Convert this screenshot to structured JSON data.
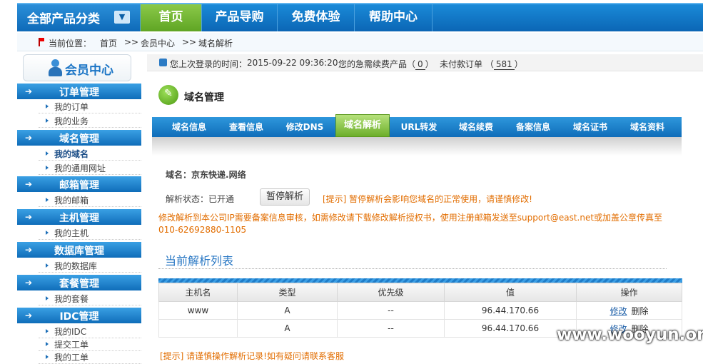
{
  "topnav": {
    "category_label": "全部产品分类",
    "arrow_glyph": "▼",
    "items": [
      "首页",
      "产品导购",
      "免费体验",
      "帮助中心"
    ]
  },
  "breadcrumb": {
    "label": "当前位置：",
    "sep": ">>",
    "items": [
      "首页",
      "会员中心",
      "域名解析"
    ]
  },
  "sidebar": {
    "title": "会员中心",
    "sections": [
      {
        "title": "订单管理",
        "items": [
          "我的订单",
          "我的业务"
        ]
      },
      {
        "title": "域名管理",
        "items": [
          "我的域名",
          "我的通用网址"
        ]
      },
      {
        "title": "邮箱管理",
        "items": [
          "我的邮箱"
        ]
      },
      {
        "title": "主机管理",
        "items": [
          "我的主机"
        ]
      },
      {
        "title": "数据库管理",
        "items": [
          "我的数据库"
        ]
      },
      {
        "title": "套餐管理",
        "items": [
          "我的套餐"
        ]
      },
      {
        "title": "IDC管理",
        "items": [
          "我的IDC",
          "提交工单",
          "我的工单"
        ]
      }
    ]
  },
  "info_bar": {
    "last_login_label": "您上次登录的时间：",
    "last_login_time": "2015-09-22 09:36:20",
    "renew_label": "您的急需续费产品（",
    "renew_count": "0",
    "unpaid_label": "未付款订单 （",
    "unpaid_count": "581",
    "close_paren": "）"
  },
  "page_title": "域名管理",
  "page_icon_glyph": "✎",
  "tabs": [
    "域名信息",
    "查看信息",
    "修改DNS",
    "域名解析",
    "URL转发",
    "域名续费",
    "备案信息",
    "域名证书",
    "域名资料"
  ],
  "active_tab": "域名解析",
  "domain": {
    "label": "域名：",
    "value": "京东快递.网络"
  },
  "status": {
    "label": "解析状态：",
    "value": "已开通",
    "pause_button": "暂停解析",
    "tip": "[提示] 暂停解析会影响您域名的正常使用，请谨慎修改!"
  },
  "notice_line1": "修改解析到本公司IP需要备案信息审核，如需修改请下载修改解析授权书，使用注册邮箱发送至support@east.net或加盖公章传真至",
  "notice_line2": "010-62692880-1105",
  "list_title": "当前解析列表",
  "table": {
    "headers": [
      "主机名",
      "类型",
      "优先级",
      "值",
      "操作"
    ],
    "rows": [
      {
        "host": "www",
        "type": "A",
        "priority": "--",
        "value": "96.44.170.66",
        "edit": "修改",
        "delete": "删除"
      },
      {
        "host": "",
        "type": "A",
        "priority": "--",
        "value": "96.44.170.66",
        "edit": "修改",
        "delete": "删除"
      }
    ]
  },
  "bottom_tip": "[提示] 请谨慎操作解析记录!如有疑问请联系客服",
  "watermark": "www.wooyun.org",
  "colors": {
    "nav_blue": "#0b66b5",
    "active_green": "#6cae2a",
    "warning_orange": "#e26d00",
    "link_blue": "#1d5fa8"
  }
}
